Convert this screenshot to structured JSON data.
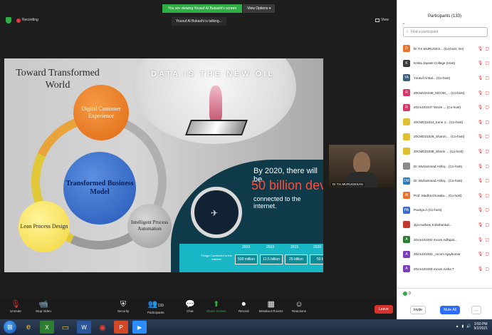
{
  "banner": {
    "viewing_text": "You are viewing Yousuf Al Bukashi's screen",
    "view_options": "View Options ▾"
  },
  "meeting": {
    "recording_label": "Recording",
    "talking_text": "Yousuf Al Bukashi is talking...",
    "view_label": "View"
  },
  "slide": {
    "title": "Toward Transformed World",
    "center_circle": "Transformed Business Model",
    "top_circle": "Digital Customer Experience",
    "left_circle": "Lean Process Design",
    "right_circle": "Intelligent Process Automation",
    "oil_title": "DATA IS THE NEW OIL",
    "by2020": "By 2020, there will be",
    "billion": "50 billion device",
    "connected": "connected to the internet.",
    "things_label": "Things Connected to the internet",
    "years": [
      "2003",
      "2010",
      "2015",
      "2020"
    ],
    "values": [
      "500 million",
      "12.5 billion",
      "25 billion",
      "50 bil"
    ]
  },
  "speaker_tile": {
    "name": "Dr.T.K.MURUGESAN"
  },
  "toolbar": {
    "unmute": "Unmute",
    "stop_video": "Stop Video",
    "security": "Security",
    "participants": "Participants",
    "participants_count": "133",
    "chat": "Chat",
    "share_screen": "Share Screen",
    "record": "Record",
    "breakout": "Breakout Rooms",
    "reactions": "Reactions",
    "leave": "Leave"
  },
  "panel": {
    "title": "Participants (133)",
    "search_placeholder": "Find a participant",
    "participants": [
      {
        "initial": "D",
        "color": "#e8732a",
        "name": "Dr.T.K.MURUGES... (Co-host, me)"
      },
      {
        "initial": "K",
        "color": "#3a3a3a",
        "name": "Krista Jayanti College (Host)"
      },
      {
        "initial": "YA",
        "color": "#3a5c7a",
        "name": "Yousuf Al Bal... (Co-host)"
      },
      {
        "initial": "R",
        "color": "#d6366a",
        "name": "20CM101048_MCOM_... (Co-host)"
      },
      {
        "initial": "R",
        "color": "#d6366a",
        "name": "20cm101047 Mcom ... (Co-host)"
      },
      {
        "initial": "",
        "color": "#e0c030",
        "name": "20CMD21014_Irene J... (Co-host)"
      },
      {
        "initial": "",
        "color": "#e0c030",
        "name": "20CMD21029_Sharon ... (Co-host)"
      },
      {
        "initial": "",
        "color": "#e0c030",
        "name": "20CMD21038_Sherin ... (Co-host)"
      },
      {
        "initial": "",
        "color": "#8a8a8a",
        "name": "Dr. Muhammad Ashiq... (Co-host)"
      },
      {
        "initial": "DM",
        "color": "#2e7ab8",
        "name": "Dr. Muhammad Ashiq... (Co-host)"
      },
      {
        "initial": "M",
        "color": "#e8732a",
        "name": "Prof. Madha Druvaku... (Co-host)"
      },
      {
        "initial": "PA",
        "color": "#3a6acf",
        "name": "Pavitya A (Co-host)"
      },
      {
        "initial": "",
        "color": "#c0392b",
        "name": "Jija mathew Kolathankal..."
      },
      {
        "initial": "A",
        "color": "#2e7d32",
        "name": "20cm101002 mcom Adhipat..."
      },
      {
        "initial": "A",
        "color": "#7b3fb8",
        "name": "20cm101003 _mcom Ajaykumar"
      },
      {
        "initial": "A",
        "color": "#7b3fb8",
        "name": "20cm101004 mcom Aisha T"
      }
    ],
    "footer_count": "0",
    "invite": "Invite",
    "mute_all": "Mute All",
    "more": "..."
  },
  "taskbar": {
    "time": "3:50 PM",
    "date": "9/2/2021"
  }
}
